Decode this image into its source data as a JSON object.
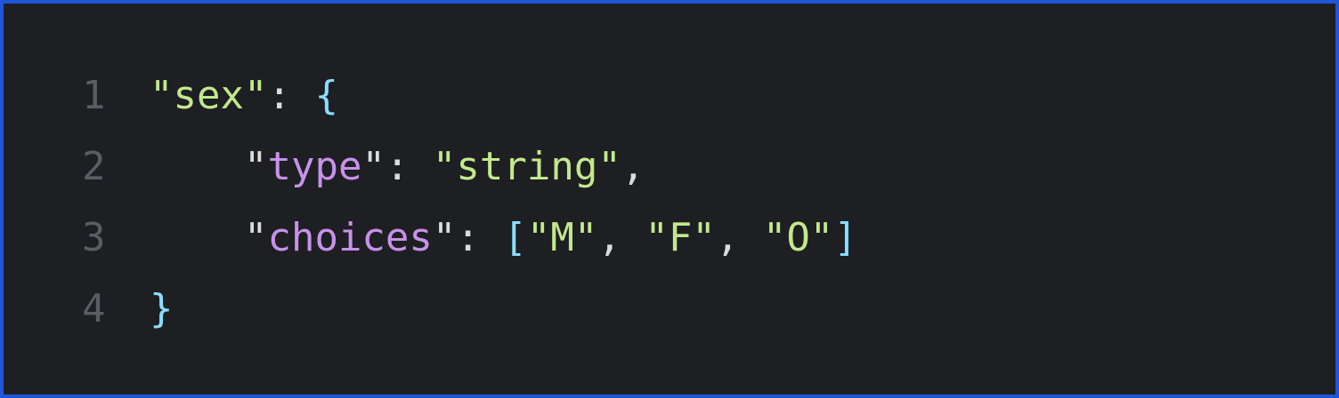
{
  "editor": {
    "lines": [
      {
        "number": "1",
        "tokens": [
          {
            "text": "\"sex\"",
            "kind": "str"
          },
          {
            "text": ": ",
            "kind": "punc"
          },
          {
            "text": "{",
            "kind": "brace"
          }
        ]
      },
      {
        "number": "2",
        "tokens": [
          {
            "text": "    ",
            "kind": "punc"
          },
          {
            "text": "\"",
            "kind": "punc"
          },
          {
            "text": "type",
            "kind": "key"
          },
          {
            "text": "\"",
            "kind": "punc"
          },
          {
            "text": ": ",
            "kind": "punc"
          },
          {
            "text": "\"string\"",
            "kind": "str"
          },
          {
            "text": ",",
            "kind": "punc"
          }
        ]
      },
      {
        "number": "3",
        "tokens": [
          {
            "text": "    ",
            "kind": "punc"
          },
          {
            "text": "\"",
            "kind": "punc"
          },
          {
            "text": "choices",
            "kind": "key"
          },
          {
            "text": "\"",
            "kind": "punc"
          },
          {
            "text": ": ",
            "kind": "punc"
          },
          {
            "text": "[",
            "kind": "brace"
          },
          {
            "text": "\"M\"",
            "kind": "str"
          },
          {
            "text": ", ",
            "kind": "punc"
          },
          {
            "text": "\"F\"",
            "kind": "str"
          },
          {
            "text": ", ",
            "kind": "punc"
          },
          {
            "text": "\"O\"",
            "kind": "str"
          },
          {
            "text": "]",
            "kind": "brace"
          }
        ]
      },
      {
        "number": "4",
        "tokens": [
          {
            "text": "}",
            "kind": "brace"
          }
        ]
      }
    ]
  },
  "colors": {
    "background": "#1e1f22",
    "border": "#1f56d8",
    "line_number": "#5a5d63",
    "string": "#c3e88d",
    "key": "#c792ea",
    "punctuation": "#dcdcdc",
    "brace": "#89ddff"
  }
}
